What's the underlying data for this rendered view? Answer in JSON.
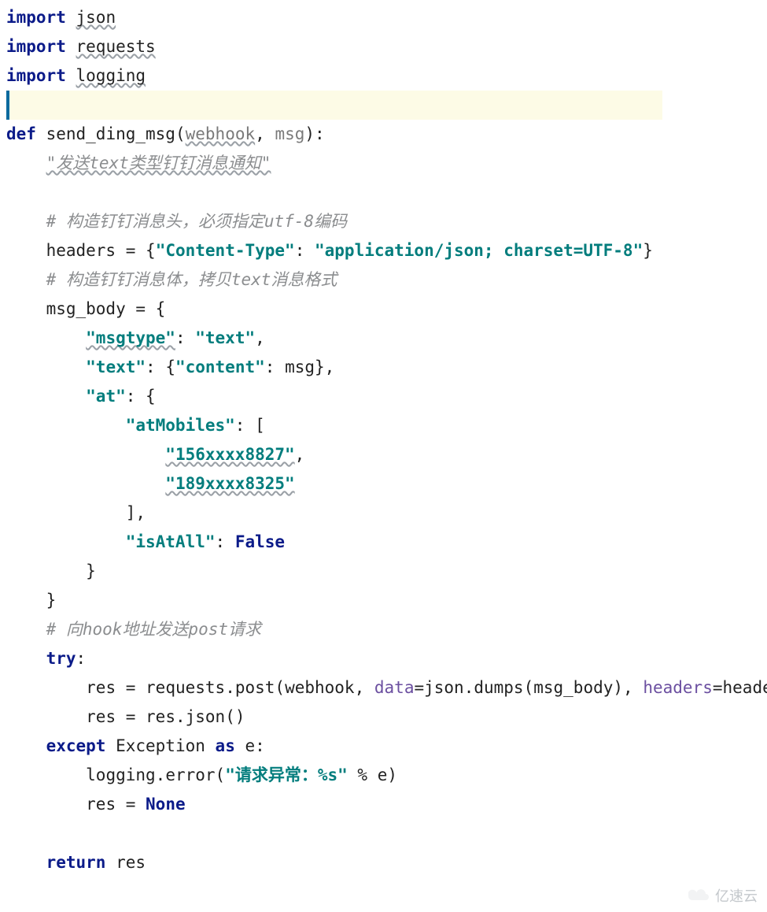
{
  "code": {
    "l01_import": "import",
    "l01_mod": "json",
    "l02_import": "import",
    "l02_mod": "requests",
    "l03_import": "import",
    "l03_mod": "logging",
    "hl_blank": " ",
    "l04_def": "def",
    "l04_name": "send_ding_msg",
    "l04_p1": "webhook",
    "l04_p2": "msg",
    "l05_doc": "\"发送text类型钉钉消息通知\"",
    "l06_comment": "# 构造钉钉消息头，必须指定utf-8编码",
    "l07_var": "headers",
    "l07_eq": " = ",
    "l07_key": "\"Content-Type\"",
    "l07_val": "\"application/json; charset=UTF-8\"",
    "l08_comment": "# 构造钉钉消息体，拷贝text消息格式",
    "l09_var": "msg_body",
    "l09_eq": " = ",
    "l10_key_msgtype": "\"msgtype\"",
    "l10_val_text": "\"text\"",
    "l11_key_text": "\"text\"",
    "l11_key_content": "\"content\"",
    "l11_val_msg": "msg",
    "l12_key_at": "\"at\"",
    "l13_key_atMobiles": "\"atMobiles\"",
    "l14_mob1": "\"156xxxx8827\"",
    "l15_mob2": "\"189xxxx8325\"",
    "l17_key_isAtAll": "\"isAtAll\"",
    "l17_false": "False",
    "l20_comment": "# 向hook地址发送post请求",
    "l21_try": "try",
    "l22_res": "res",
    "l22_eq": " = ",
    "l22_req": "requests",
    "l22_post": "post",
    "l22_webhook": "webhook",
    "l22_data": "data",
    "l22_json": "json",
    "l22_dumps": "dumps",
    "l22_msgbody": "msg_body",
    "l22_headers": "headers",
    "l22_headersv": "headers",
    "l23_res": "res",
    "l23_eq": " = ",
    "l23_resjson": "res",
    "l23_json": "json",
    "l24_except": "except",
    "l24_Exception": "Exception",
    "l24_as": "as",
    "l24_e": "e",
    "l25_logging": "logging",
    "l25_error": "error",
    "l25_str": "\"请求异常：%s\"",
    "l25_pct": " % ",
    "l25_e": "e",
    "l26_res": "res",
    "l26_eq": " = ",
    "l26_none": "None",
    "l27_return": "return",
    "l27_res": "res"
  },
  "watermark": "亿速云"
}
